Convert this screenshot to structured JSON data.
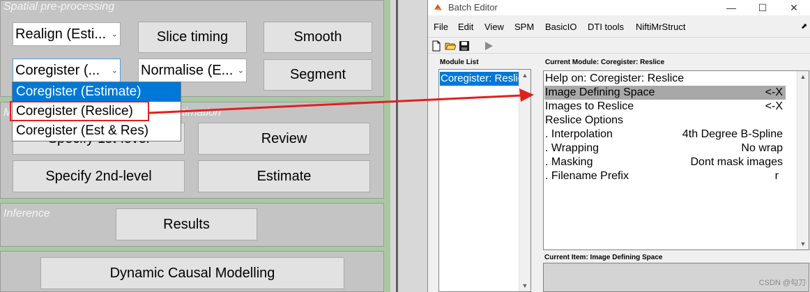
{
  "spm_menu": {
    "spatial": {
      "title": "Spatial pre-processing",
      "realign_select": "Realign (Esti...",
      "slice_timing": "Slice timing",
      "smooth": "Smooth",
      "coregister_select": "Coregister (...",
      "normalise_select": "Normalise (E...",
      "segment": "Segment"
    },
    "coregister_dropdown": {
      "options": [
        "Coregister (Estimate)",
        "Coregister (Reslice)",
        "Coregister (Est & Res)"
      ],
      "highlighted_index": 0
    },
    "model": {
      "title_partial": "M",
      "title_tail": "timation",
      "specify_1st": "Specify 1st-level",
      "review": "Review",
      "specify_2nd": "Specify 2nd-level",
      "estimate": "Estimate"
    },
    "inference": {
      "title": "Inference",
      "results": "Results"
    },
    "dcm": "Dynamic Causal Modelling"
  },
  "batch_editor": {
    "window_title": "Batch Editor",
    "menu": [
      "File",
      "Edit",
      "View",
      "SPM",
      "BasicIO",
      "DTI tools",
      "NiftiMrStruct"
    ],
    "module_list_label": "Module List",
    "module_list_items": [
      "Coregister: Reslice"
    ],
    "current_module_label": "Current Module: Coregister: Reslice",
    "current_module_rows": [
      {
        "key": "Help on: Coregister: Reslice",
        "value": ""
      },
      {
        "key": "Image Defining Space",
        "value": "<-X"
      },
      {
        "key": "Images to Reslice",
        "value": "<-X"
      },
      {
        "key": "Reslice Options",
        "value": ""
      },
      {
        "key": ". Interpolation",
        "value": "4th Degree B-Spline"
      },
      {
        "key": ". Wrapping",
        "value": "No wrap"
      },
      {
        "key": ". Masking",
        "value": "Dont mask images"
      },
      {
        "key": ". Filename Prefix",
        "value": "r"
      }
    ],
    "selected_row_index": 1,
    "current_item_label": "Current Item: Image Defining Space"
  },
  "watermark": "CSDN @勾刀",
  "colors": {
    "panel_bg": "#c4c4c4",
    "window_bg": "#a8c9a0",
    "highlight_blue": "#0078d7",
    "annotation_red": "#e02020",
    "selected_row": "#a8a8a8"
  }
}
